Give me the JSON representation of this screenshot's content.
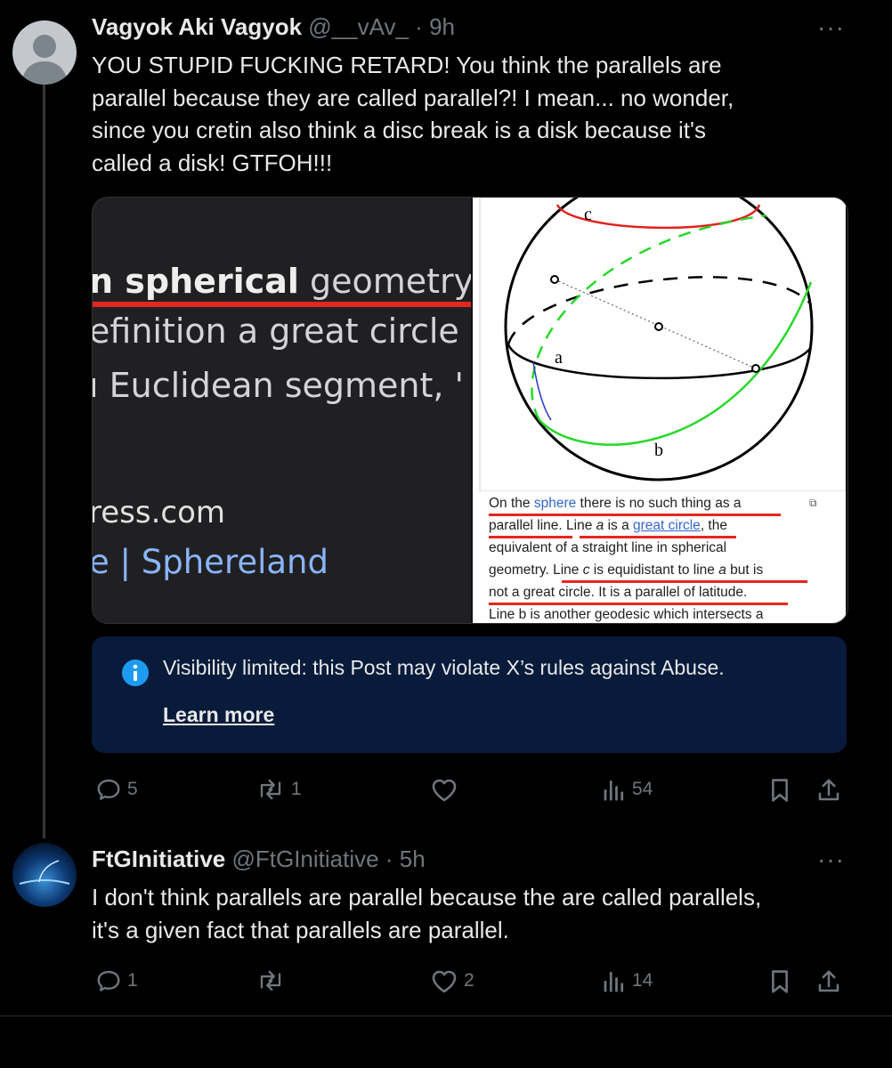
{
  "post1": {
    "display_name": "Vagyok Aki Vagyok",
    "handle": "@__vAv_",
    "separator": "·",
    "time": "9h",
    "more": "···",
    "text_lines": [
      "YOU STUPID FUCKING RETARD! You think the parallels are",
      "parallel because they are called parallel?! I mean... no wonder,",
      "since you cretin also think a disc break is a disk because it's",
      "called a disk! GTFOH!!!"
    ],
    "media": {
      "left_snippet": [
        "n spherical geometry",
        "efinition a great circle",
        "ı Euclidean segment, '"
      ],
      "left_highlight": "spherical",
      "left_link_domain": "ress.com",
      "left_link_title": "e | Sphereland",
      "diagram_labels": {
        "c": "c",
        "a": "a",
        "b": "b"
      },
      "caption": {
        "l1_pre": "On the ",
        "l1_link": "sphere",
        "l1_post": " there is no such thing as a",
        "l2_a": "parallel line.",
        "l2_b": " Line ",
        "l2_ital": "a",
        "l2_c": " is a ",
        "l2_link": "great circle",
        "l2_d": ", the",
        "l3": "equivalent of a straight line in spherical",
        "l4_a": "geometry. ",
        "l4_b": "Line ",
        "l4_ital1": "c",
        "l4_c": " is equidistant to line ",
        "l4_ital2": "a",
        "l4_d": " but is",
        "l5": "not a great circle. It is a parallel of latitude.",
        "l6": "Line b is another geodesic which intersects a"
      }
    },
    "notice": {
      "text": "Visibility limited: this Post may violate X’s rules against Abuse.",
      "link": "Learn more"
    },
    "actions": {
      "replies": "5",
      "reposts": "1",
      "likes": "",
      "views": "54"
    }
  },
  "post2": {
    "display_name": "FtGInitiative",
    "handle": "@FtGInitiative",
    "separator": "·",
    "time": "5h",
    "more": "···",
    "text_lines": [
      "I don't think parallels are parallel because the are called parallels,",
      "it's a given fact that parallels are parallel."
    ],
    "actions": {
      "replies": "1",
      "reposts": "",
      "likes": "2",
      "views": "14"
    }
  },
  "colors": {
    "background": "#000000",
    "text": "#e7e9ea",
    "muted": "#71767b",
    "notice_bg": "#091b3a",
    "accent": "#1d9bf0",
    "underline_red": "#e5271f"
  }
}
